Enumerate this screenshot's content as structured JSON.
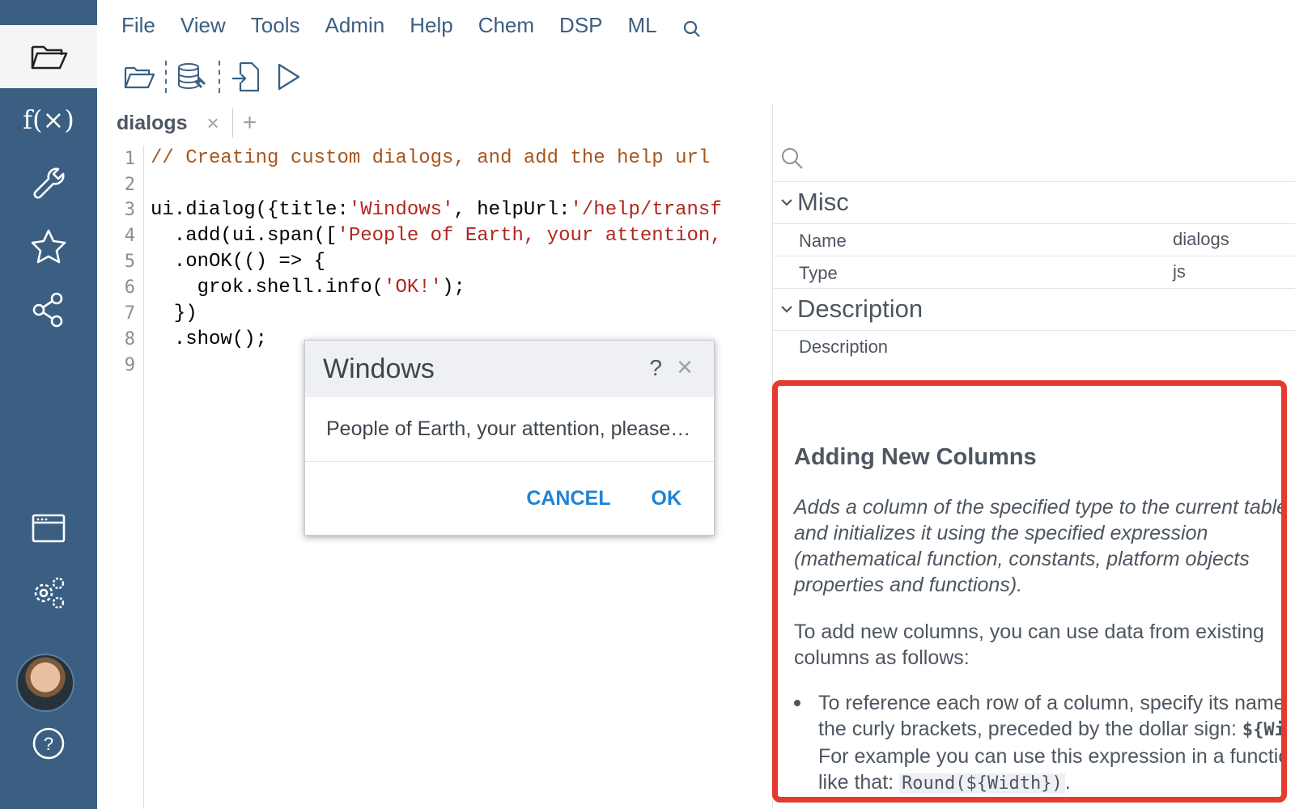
{
  "menu": {
    "items": [
      "File",
      "View",
      "Tools",
      "Admin",
      "Help",
      "Chem",
      "DSP",
      "ML"
    ],
    "search_icon": "search-icon"
  },
  "sidebar": {
    "items": [
      {
        "icon": "folder-open-icon",
        "active": true
      },
      {
        "icon": "function-icon",
        "label": "f(×)"
      },
      {
        "icon": "wrench-icon"
      },
      {
        "icon": "star-icon"
      },
      {
        "icon": "share-icon"
      },
      {
        "icon": "window-icon"
      },
      {
        "icon": "settings-icon"
      },
      {
        "icon": "avatar"
      },
      {
        "icon": "help-icon",
        "label": "?"
      }
    ]
  },
  "toolbar": {
    "icons": [
      "open-folder-icon",
      "database-plug-icon",
      "import-file-icon",
      "play-icon"
    ]
  },
  "tab": {
    "name": "dialogs",
    "close": "×",
    "add": "+"
  },
  "editor": {
    "line_numbers": [
      "1",
      "2",
      "3",
      "4",
      "5",
      "6",
      "7",
      "8",
      "9"
    ],
    "lines": {
      "l1_comment": "// Creating custom dialogs, and add the help url",
      "l3_a": "ui.dialog({title:",
      "l3_b": "'Windows'",
      "l3_c": ", helpUrl:",
      "l3_d": "'/help/transf",
      "l4_a": "  .add(ui.span([",
      "l4_b": "'People of Earth, your attention,",
      "l5": "  .onOK(() => {",
      "l6_a": "    grok.shell.info(",
      "l6_b": "'OK!'",
      "l6_c": ");",
      "l7": "  })",
      "l8": "  .show();"
    }
  },
  "dialog": {
    "title": "Windows",
    "help": "?",
    "close": "×",
    "message": "People of Earth, your attention, please…",
    "cancel_label": "CANCEL",
    "ok_label": "OK"
  },
  "properties": {
    "misc_header": "Misc",
    "name_label": "Name",
    "name_value": "dialogs",
    "type_label": "Type",
    "type_value": "js",
    "description_header": "Description",
    "description_label": "Description"
  },
  "help": {
    "title": "Adding New Columns",
    "intro": "Adds a column of the specified type to the current table and initializes it using the specified expression (mathematical function, constants, platform objects properties and functions).",
    "para": "To add new columns, you can use data from existing columns as follows:",
    "bullet_a": "To reference each row of a column, specify its name in the curly brackets, preceded by the dollar sign: ",
    "bullet_code1": "${Width}",
    "bullet_b": ". For example you can use this expression in a function like that: ",
    "bullet_code2": "Round(${Width})",
    "bullet_c": "."
  },
  "colors": {
    "sidebar": "#3b5f82",
    "menu_text": "#3b5f82",
    "dialog_button": "#2083d5",
    "highlight_border": "#e53a2f",
    "code_comment": "#a8551d",
    "code_string": "#b3261e"
  }
}
